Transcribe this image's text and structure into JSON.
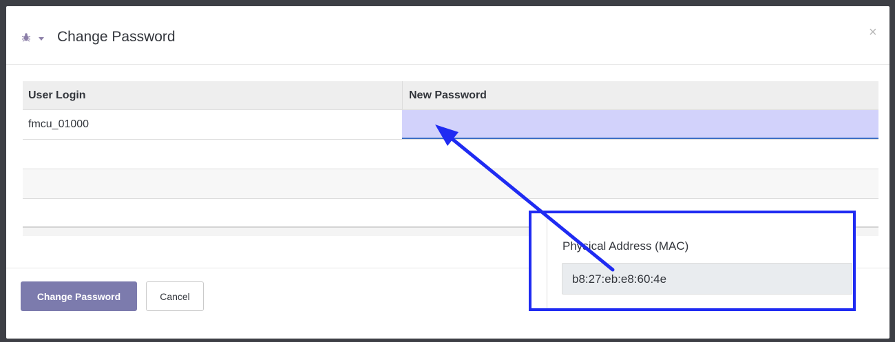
{
  "dialog": {
    "title": "Change Password",
    "close_glyph": "×",
    "debug_icon": "bug-icon",
    "caret_icon": "caret-down-icon"
  },
  "grid": {
    "columns": [
      "User Login",
      "New Password"
    ],
    "rows": [
      {
        "user_login": "fmcu_01000",
        "new_password": ""
      }
    ]
  },
  "footer": {
    "primary_label": "Change Password",
    "cancel_label": "Cancel"
  },
  "annotation": {
    "label": "Physical Address (MAC)",
    "value": "b8:27:eb:e8:60:4e",
    "accent_color": "#1f2bf2"
  },
  "colors": {
    "primary_button": "#7c7bad",
    "highlight_input": "#d2d2fb",
    "input_underline": "#3c6fc4"
  }
}
